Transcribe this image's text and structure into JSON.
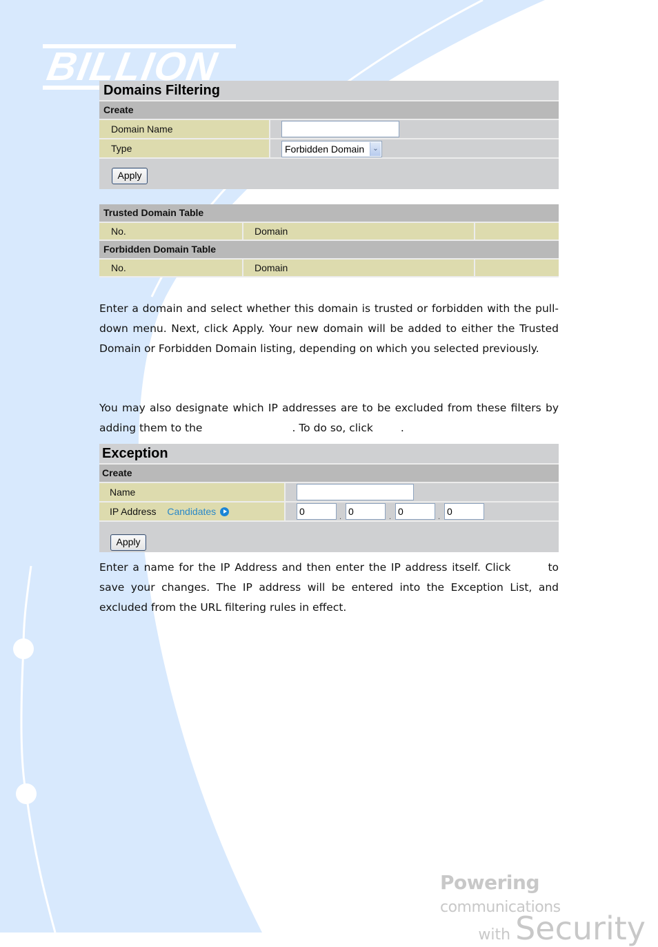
{
  "brand": {
    "logo_text": "BILLION",
    "tagline_bold": "Powering",
    "tagline_rest": "communications",
    "tagline_with": "with",
    "tagline_security": "Security",
    "background_color": "#d8e9fd"
  },
  "domains_filtering": {
    "title": "Domains Filtering",
    "create_section": "Create",
    "fields": {
      "domain_name_label": "Domain Name",
      "domain_name_value": "",
      "type_label": "Type",
      "type_selected": "Forbidden Domain"
    },
    "apply_label": "Apply",
    "trusted_table": {
      "title": "Trusted Domain Table",
      "columns": [
        "No.",
        "Domain",
        ""
      ]
    },
    "forbidden_table": {
      "title": "Forbidden Domain Table",
      "columns": [
        "No.",
        "Domain",
        ""
      ]
    }
  },
  "text": {
    "para1": "Enter a domain and select whether this domain is trusted or forbidden with the pull-down menu. Next, click Apply. Your new domain will be added to either the Trusted Domain or Forbidden Domain listing, depending on which you selected previously.",
    "para2_a": "You may also designate which IP addresses are to be excluded from these filters by adding them to the",
    "para2_b": ". To do so, click",
    "para2_c": ".",
    "para3_a": "Enter a name for the IP Address and then enter the IP address itself. Click",
    "para3_b": "to save your changes. The IP address will be entered into the Exception List, and excluded from the URL filtering rules in effect."
  },
  "exception": {
    "title": "Exception",
    "create_section": "Create",
    "name_label": "Name",
    "name_value": "",
    "ip_label": "IP Address",
    "candidates_link": "Candidates",
    "ip_octets": [
      "0",
      "0",
      "0",
      "0"
    ],
    "ip_separator": ".",
    "apply_label": "Apply"
  }
}
